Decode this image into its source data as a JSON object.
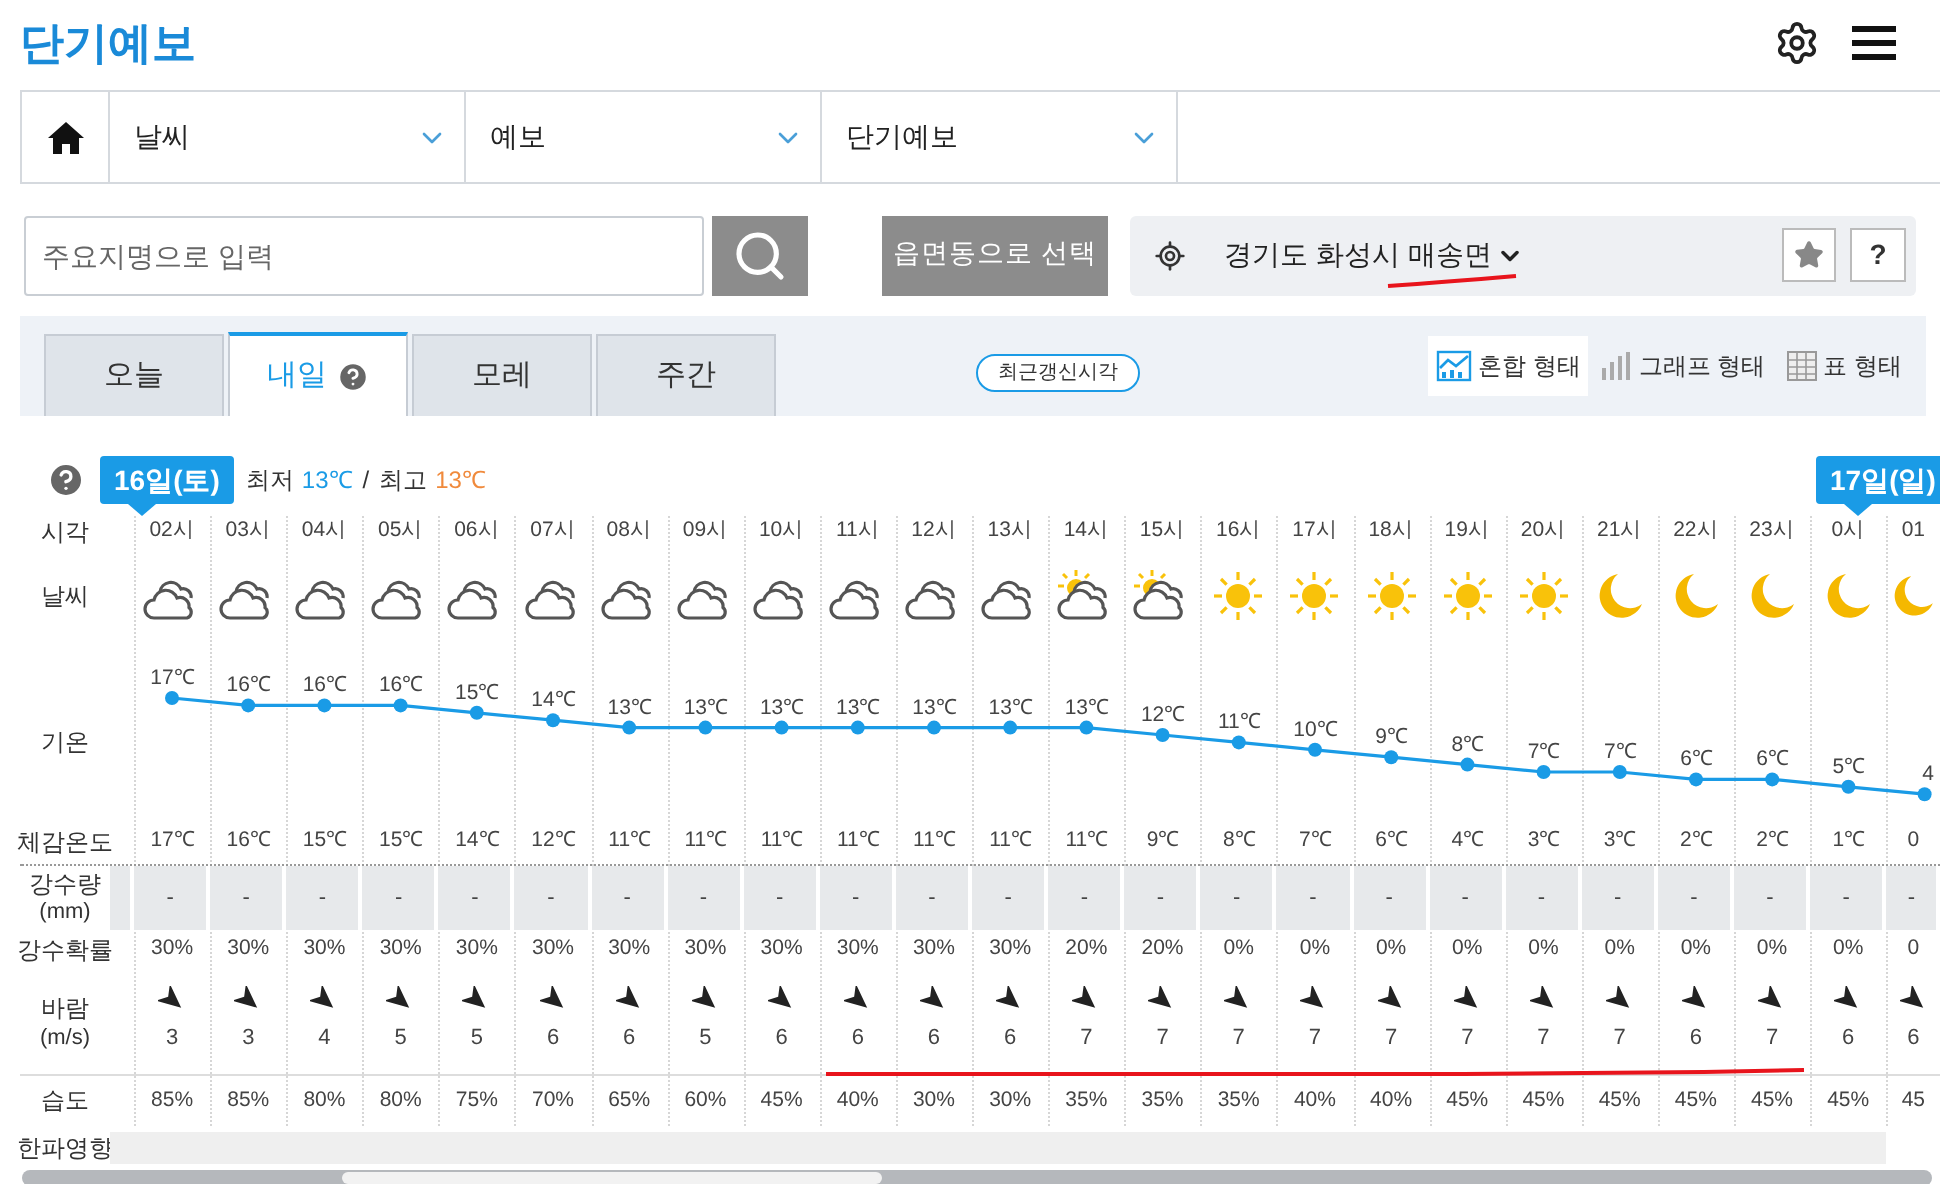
{
  "header": {
    "title": "단기예보"
  },
  "nav": {
    "items": [
      {
        "label": "날씨"
      },
      {
        "label": "예보"
      },
      {
        "label": "단기예보"
      }
    ]
  },
  "search": {
    "placeholder": "주요지명으로 입력",
    "region_button": "읍면동으로 선택",
    "location": "경기도 화성시 매송면",
    "help": "?"
  },
  "day_tabs": [
    {
      "label": "오늘",
      "selected": false
    },
    {
      "label": "내일",
      "selected": true
    },
    {
      "label": "모레",
      "selected": false
    },
    {
      "label": "주간",
      "selected": false
    }
  ],
  "update_button": "최근갱신시각",
  "view_modes": [
    {
      "label": "혼합 형태",
      "kind": "mixed",
      "selected": true
    },
    {
      "label": "그래프 형태",
      "kind": "graph",
      "selected": false
    },
    {
      "label": "표 형태",
      "kind": "table",
      "selected": false
    }
  ],
  "forecast": {
    "row_labels": {
      "time": "시각",
      "sky": "날씨",
      "temp": "기온",
      "feels": "체감온도",
      "rain": "강수량",
      "rain_unit": "(mm)",
      "prob": "강수확률",
      "wind": "바람",
      "wind_unit": "(m/s)",
      "humidity": "습도",
      "cold": "한파영향"
    },
    "dates": [
      {
        "label": "16일(토)",
        "low_label": "최저",
        "low": "13℃",
        "separator": "/",
        "high_label": "최고",
        "high": "13℃"
      },
      {
        "label": "17일(일)"
      }
    ],
    "hours": [
      {
        "time": "02시",
        "kind": "cloudy",
        "temp": "17℃",
        "feels": "17℃",
        "rain": "-",
        "prob": "30%",
        "wind": "3",
        "humidity": "85%"
      },
      {
        "time": "03시",
        "kind": "cloudy",
        "temp": "16℃",
        "feels": "16℃",
        "rain": "-",
        "prob": "30%",
        "wind": "3",
        "humidity": "85%"
      },
      {
        "time": "04시",
        "kind": "cloudy",
        "temp": "16℃",
        "feels": "15℃",
        "rain": "-",
        "prob": "30%",
        "wind": "4",
        "humidity": "80%"
      },
      {
        "time": "05시",
        "kind": "cloudy",
        "temp": "16℃",
        "feels": "15℃",
        "rain": "-",
        "prob": "30%",
        "wind": "5",
        "humidity": "80%"
      },
      {
        "time": "06시",
        "kind": "cloudy",
        "temp": "15℃",
        "feels": "14℃",
        "rain": "-",
        "prob": "30%",
        "wind": "5",
        "humidity": "75%"
      },
      {
        "time": "07시",
        "kind": "cloudy",
        "temp": "14℃",
        "feels": "12℃",
        "rain": "-",
        "prob": "30%",
        "wind": "6",
        "humidity": "70%"
      },
      {
        "time": "08시",
        "kind": "cloudy",
        "temp": "13℃",
        "feels": "11℃",
        "rain": "-",
        "prob": "30%",
        "wind": "6",
        "humidity": "65%"
      },
      {
        "time": "09시",
        "kind": "cloudy",
        "temp": "13℃",
        "feels": "11℃",
        "rain": "-",
        "prob": "30%",
        "wind": "5",
        "humidity": "60%"
      },
      {
        "time": "10시",
        "kind": "cloudy",
        "temp": "13℃",
        "feels": "11℃",
        "rain": "-",
        "prob": "30%",
        "wind": "6",
        "humidity": "45%"
      },
      {
        "time": "11시",
        "kind": "cloudy",
        "temp": "13℃",
        "feels": "11℃",
        "rain": "-",
        "prob": "30%",
        "wind": "6",
        "humidity": "40%"
      },
      {
        "time": "12시",
        "kind": "cloudy",
        "temp": "13℃",
        "feels": "11℃",
        "rain": "-",
        "prob": "30%",
        "wind": "6",
        "humidity": "30%"
      },
      {
        "time": "13시",
        "kind": "cloudy",
        "temp": "13℃",
        "feels": "11℃",
        "rain": "-",
        "prob": "30%",
        "wind": "6",
        "humidity": "30%"
      },
      {
        "time": "14시",
        "kind": "partly_cloudy",
        "temp": "13℃",
        "feels": "11℃",
        "rain": "-",
        "prob": "20%",
        "wind": "7",
        "humidity": "35%"
      },
      {
        "time": "15시",
        "kind": "partly_cloudy",
        "temp": "12℃",
        "feels": "9℃",
        "rain": "-",
        "prob": "20%",
        "wind": "7",
        "humidity": "35%"
      },
      {
        "time": "16시",
        "kind": "sunny",
        "temp": "11℃",
        "feels": "8℃",
        "rain": "-",
        "prob": "0%",
        "wind": "7",
        "humidity": "35%"
      },
      {
        "time": "17시",
        "kind": "sunny",
        "temp": "10℃",
        "feels": "7℃",
        "rain": "-",
        "prob": "0%",
        "wind": "7",
        "humidity": "40%"
      },
      {
        "time": "18시",
        "kind": "sunny",
        "temp": "9℃",
        "feels": "6℃",
        "rain": "-",
        "prob": "0%",
        "wind": "7",
        "humidity": "40%"
      },
      {
        "time": "19시",
        "kind": "sunny",
        "temp": "8℃",
        "feels": "4℃",
        "rain": "-",
        "prob": "0%",
        "wind": "7",
        "humidity": "45%"
      },
      {
        "time": "20시",
        "kind": "sunny",
        "temp": "7℃",
        "feels": "3℃",
        "rain": "-",
        "prob": "0%",
        "wind": "7",
        "humidity": "45%"
      },
      {
        "time": "21시",
        "kind": "clear_night",
        "temp": "7℃",
        "feels": "3℃",
        "rain": "-",
        "prob": "0%",
        "wind": "7",
        "humidity": "45%"
      },
      {
        "time": "22시",
        "kind": "clear_night",
        "temp": "6℃",
        "feels": "2℃",
        "rain": "-",
        "prob": "0%",
        "wind": "6",
        "humidity": "45%"
      },
      {
        "time": "23시",
        "kind": "clear_night",
        "temp": "6℃",
        "feels": "2℃",
        "rain": "-",
        "prob": "0%",
        "wind": "7",
        "humidity": "45%"
      },
      {
        "time": "0시",
        "kind": "clear_night",
        "temp": "5℃",
        "feels": "1℃",
        "rain": "-",
        "prob": "0%",
        "wind": "6",
        "humidity": "45%"
      },
      {
        "time": "01",
        "kind": "clear_night",
        "temp": "4",
        "feels": "0",
        "rain": "-",
        "prob": "0",
        "wind": "6",
        "humidity": "45"
      }
    ]
  }
}
